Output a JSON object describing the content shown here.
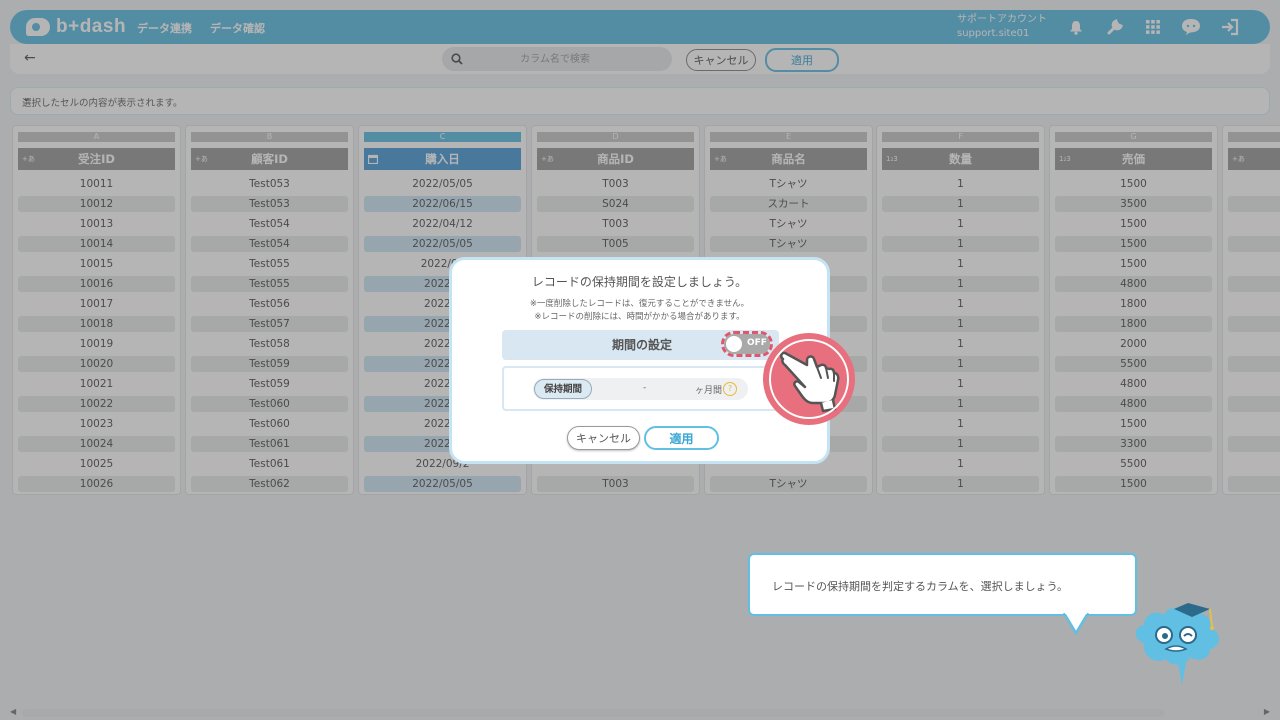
{
  "header": {
    "logo": "b+dash",
    "nav": [
      "データ連携",
      "データ確認"
    ],
    "account_name": "サポートアカウント",
    "account_id": "support.site01",
    "icons": [
      "bell-icon",
      "wrench-icon",
      "grid-icon",
      "chat-icon",
      "logout-icon"
    ]
  },
  "toolbar": {
    "back_icon": "←",
    "search_placeholder": "カラム名で検索",
    "cancel_label": "キャンセル",
    "apply_label": "適用"
  },
  "cellbar": {
    "text": "選択したセルの内容が表示されます。"
  },
  "table": {
    "columns": [
      {
        "letter": "A",
        "type": "+あ",
        "name": "受注ID"
      },
      {
        "letter": "B",
        "type": "+あ",
        "name": "顧客ID"
      },
      {
        "letter": "C",
        "type": "cal",
        "name": "購入日"
      },
      {
        "letter": "D",
        "type": "+あ",
        "name": "商品ID"
      },
      {
        "letter": "E",
        "type": "+あ",
        "name": "商品名"
      },
      {
        "letter": "F",
        "type": "1₂3",
        "name": "数量"
      },
      {
        "letter": "G",
        "type": "1₂3",
        "name": "売価"
      }
    ],
    "col_a": [
      "10011",
      "10012",
      "10013",
      "10014",
      "10015",
      "10016",
      "10017",
      "10018",
      "10019",
      "10020",
      "10021",
      "10022",
      "10023",
      "10024",
      "10025",
      "10026"
    ],
    "col_b": [
      "Test053",
      "Test053",
      "Test054",
      "Test054",
      "Test055",
      "Test055",
      "Test056",
      "Test057",
      "Test058",
      "Test059",
      "Test059",
      "Test060",
      "Test060",
      "Test061",
      "Test061",
      "Test062"
    ],
    "col_c": [
      "2022/05/05",
      "2022/06/15",
      "2022/04/12",
      "2022/05/05",
      "2022/06",
      "2022/0",
      "2022/0",
      "2022/0",
      "2022/0",
      "2022/0",
      "2022/1",
      "2022/0",
      "2022/1",
      "2022/0",
      "2022/09/2",
      "2022/05/05"
    ],
    "col_d": [
      "T003",
      "S024",
      "T003",
      "T005",
      "",
      "",
      "",
      "",
      "",
      "",
      "",
      "",
      "",
      "",
      "",
      "T003"
    ],
    "col_e": [
      "Tシャツ",
      "スカート",
      "Tシャツ",
      "Tシャツ",
      "",
      "",
      "",
      "",
      "",
      "",
      "",
      "",
      "",
      "",
      "",
      "Tシャツ"
    ],
    "col_f": [
      "1",
      "1",
      "1",
      "1",
      "1",
      "1",
      "1",
      "1",
      "1",
      "1",
      "1",
      "1",
      "1",
      "1",
      "1",
      "1"
    ],
    "col_g": [
      "1500",
      "3500",
      "1500",
      "1500",
      "1500",
      "4800",
      "1800",
      "1800",
      "2000",
      "5500",
      "4800",
      "4800",
      "1500",
      "3300",
      "5500",
      "1500"
    ]
  },
  "modal": {
    "title": "レコードの保持期間を設定しましょう。",
    "note1": "※一度削除したレコードは、復元することができません。",
    "note2": "※レコードの削除には、時間がかかる場合があります。",
    "period_label": "期間の設定",
    "toggle_state": "OFF",
    "retain_label": "保持期間",
    "retain_value": "-",
    "retain_unit": "ヶ月間",
    "help": "?",
    "cancel_label": "キャンセル",
    "apply_label": "適用"
  },
  "tooltip": {
    "text": "レコードの保持期間を判定するカラムを、選択しましょう。"
  },
  "colors": {
    "accent": "#61bfe3",
    "highlight": "#e8707e"
  }
}
